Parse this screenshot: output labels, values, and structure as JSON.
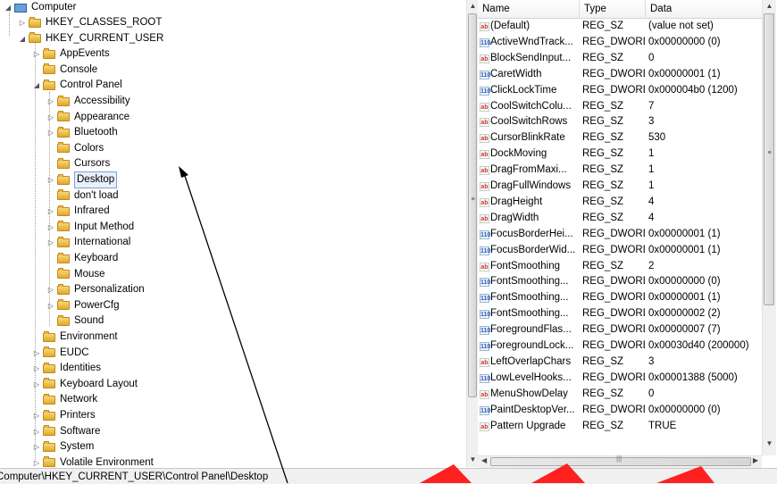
{
  "tree": {
    "root": "Computer",
    "items": [
      {
        "label": "HKEY_CLASSES_ROOT",
        "expander": "▷"
      },
      {
        "label": "HKEY_CURRENT_USER",
        "expander": "◢"
      },
      {
        "label": "AppEvents",
        "expander": "▷"
      },
      {
        "label": "Console",
        "expander": ""
      },
      {
        "label": "Control Panel",
        "expander": "◢"
      },
      {
        "label": "Accessibility",
        "expander": "▷"
      },
      {
        "label": "Appearance",
        "expander": "▷"
      },
      {
        "label": "Bluetooth",
        "expander": "▷"
      },
      {
        "label": "Colors",
        "expander": ""
      },
      {
        "label": "Cursors",
        "expander": ""
      },
      {
        "label": "Desktop",
        "expander": "▷",
        "selected": true
      },
      {
        "label": "don't load",
        "expander": ""
      },
      {
        "label": "Infrared",
        "expander": "▷"
      },
      {
        "label": "Input Method",
        "expander": "▷"
      },
      {
        "label": "International",
        "expander": "▷"
      },
      {
        "label": "Keyboard",
        "expander": ""
      },
      {
        "label": "Mouse",
        "expander": ""
      },
      {
        "label": "Personalization",
        "expander": "▷"
      },
      {
        "label": "PowerCfg",
        "expander": "▷"
      },
      {
        "label": "Sound",
        "expander": ""
      },
      {
        "label": "Environment",
        "expander": ""
      },
      {
        "label": "EUDC",
        "expander": "▷"
      },
      {
        "label": "Identities",
        "expander": "▷"
      },
      {
        "label": "Keyboard Layout",
        "expander": "▷"
      },
      {
        "label": "Network",
        "expander": ""
      },
      {
        "label": "Printers",
        "expander": "▷"
      },
      {
        "label": "Software",
        "expander": "▷"
      },
      {
        "label": "System",
        "expander": "▷"
      },
      {
        "label": "Volatile Environment",
        "expander": "▷"
      }
    ]
  },
  "list": {
    "headers": {
      "name": "Name",
      "type": "Type",
      "data": "Data"
    },
    "rows": [
      {
        "name": "(Default)",
        "type": "REG_SZ",
        "data": "(value not set)",
        "kind": "sz"
      },
      {
        "name": "ActiveWndTrack...",
        "type": "REG_DWORD",
        "data": "0x00000000 (0)",
        "kind": "dword"
      },
      {
        "name": "BlockSendInput...",
        "type": "REG_SZ",
        "data": "0",
        "kind": "sz"
      },
      {
        "name": "CaretWidth",
        "type": "REG_DWORD",
        "data": "0x00000001 (1)",
        "kind": "dword"
      },
      {
        "name": "ClickLockTime",
        "type": "REG_DWORD",
        "data": "0x000004b0 (1200)",
        "kind": "dword"
      },
      {
        "name": "CoolSwitchColu...",
        "type": "REG_SZ",
        "data": "7",
        "kind": "sz"
      },
      {
        "name": "CoolSwitchRows",
        "type": "REG_SZ",
        "data": "3",
        "kind": "sz"
      },
      {
        "name": "CursorBlinkRate",
        "type": "REG_SZ",
        "data": "530",
        "kind": "sz"
      },
      {
        "name": "DockMoving",
        "type": "REG_SZ",
        "data": "1",
        "kind": "sz"
      },
      {
        "name": "DragFromMaxi...",
        "type": "REG_SZ",
        "data": "1",
        "kind": "sz"
      },
      {
        "name": "DragFullWindows",
        "type": "REG_SZ",
        "data": "1",
        "kind": "sz"
      },
      {
        "name": "DragHeight",
        "type": "REG_SZ",
        "data": "4",
        "kind": "sz"
      },
      {
        "name": "DragWidth",
        "type": "REG_SZ",
        "data": "4",
        "kind": "sz"
      },
      {
        "name": "FocusBorderHei...",
        "type": "REG_DWORD",
        "data": "0x00000001 (1)",
        "kind": "dword"
      },
      {
        "name": "FocusBorderWid...",
        "type": "REG_DWORD",
        "data": "0x00000001 (1)",
        "kind": "dword"
      },
      {
        "name": "FontSmoothing",
        "type": "REG_SZ",
        "data": "2",
        "kind": "sz"
      },
      {
        "name": "FontSmoothing...",
        "type": "REG_DWORD",
        "data": "0x00000000 (0)",
        "kind": "dword"
      },
      {
        "name": "FontSmoothing...",
        "type": "REG_DWORD",
        "data": "0x00000001 (1)",
        "kind": "dword"
      },
      {
        "name": "FontSmoothing...",
        "type": "REG_DWORD",
        "data": "0x00000002 (2)",
        "kind": "dword"
      },
      {
        "name": "ForegroundFlas...",
        "type": "REG_DWORD",
        "data": "0x00000007 (7)",
        "kind": "dword"
      },
      {
        "name": "ForegroundLock...",
        "type": "REG_DWORD",
        "data": "0x00030d40 (200000)",
        "kind": "dword"
      },
      {
        "name": "LeftOverlapChars",
        "type": "REG_SZ",
        "data": "3",
        "kind": "sz"
      },
      {
        "name": "LowLevelHooks...",
        "type": "REG_DWORD",
        "data": "0x00001388 (5000)",
        "kind": "dword"
      },
      {
        "name": "MenuShowDelay",
        "type": "REG_SZ",
        "data": "0",
        "kind": "sz"
      },
      {
        "name": "PaintDesktopVer...",
        "type": "REG_DWORD",
        "data": "0x00000000 (0)",
        "kind": "dword"
      },
      {
        "name": "Pattern Upgrade",
        "type": "REG_SZ",
        "data": "TRUE",
        "kind": "sz"
      }
    ]
  },
  "icons": {
    "sz": "ab",
    "dword": "110"
  },
  "status": {
    "path": "Computer\\HKEY_CURRENT_USER\\Control Panel\\Desktop"
  },
  "colors": {
    "annotation_red": "#ff2020",
    "selection_border": "#7da2ce"
  }
}
